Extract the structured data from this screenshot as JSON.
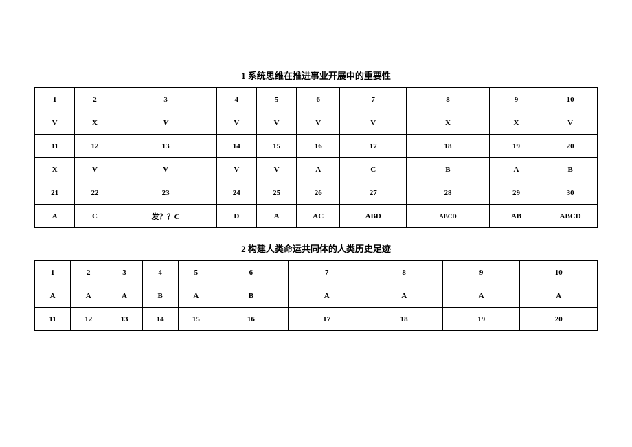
{
  "table1": {
    "title": "1 系统思维在推进事业开展中的重要性",
    "rows": [
      [
        "1",
        "2",
        "3",
        "4",
        "5",
        "6",
        "7",
        "8",
        "9",
        "10"
      ],
      [
        "V",
        "X",
        "V",
        "V",
        "V",
        "V",
        "V",
        "X",
        "X",
        "V"
      ],
      [
        "11",
        "12",
        "13",
        "14",
        "15",
        "16",
        "17",
        "18",
        "19",
        "20"
      ],
      [
        "X",
        "V",
        "V",
        "V",
        "V",
        "A",
        "C",
        "B",
        "A",
        "B"
      ],
      [
        "21",
        "22",
        "23",
        "24",
        "25",
        "26",
        "27",
        "28",
        "29",
        "30"
      ],
      [
        "A",
        "C",
        "发？？C",
        "D",
        "A",
        "AC",
        "ABD",
        "ABCD",
        "AB",
        "ABCD"
      ]
    ]
  },
  "table2": {
    "title": "2 构建人类命运共同体的人类历史足迹",
    "rows": [
      [
        "1",
        "2",
        "3",
        "4",
        "5",
        "6",
        "7",
        "8",
        "9",
        "10"
      ],
      [
        "A",
        "A",
        "A",
        "B",
        "A",
        "B",
        "A",
        "A",
        "A",
        "A"
      ],
      [
        "11",
        "12",
        "13",
        "14",
        "15",
        "16",
        "17",
        "18",
        "19",
        "20"
      ]
    ]
  }
}
